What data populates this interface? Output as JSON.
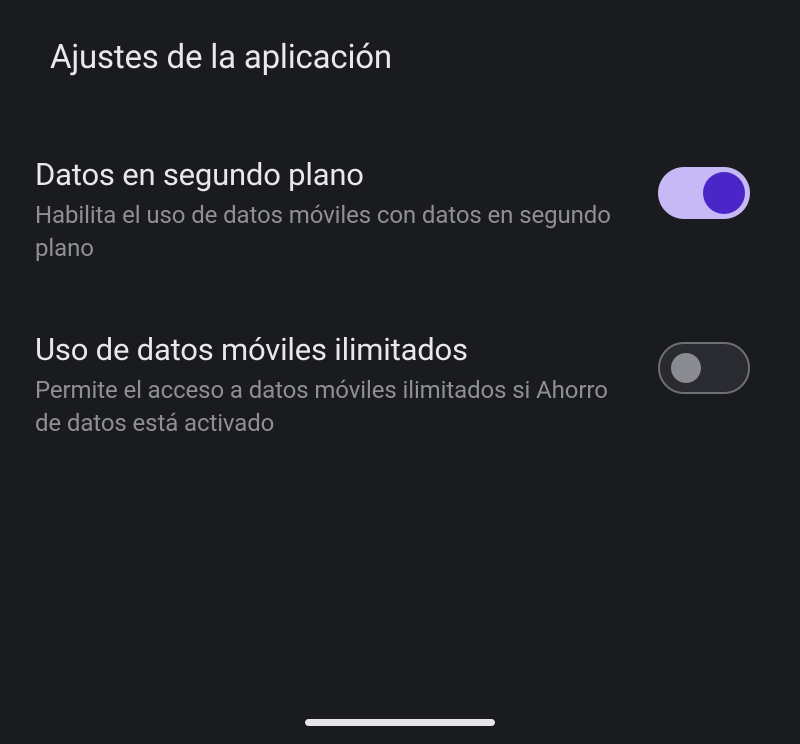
{
  "header": {
    "title": "Ajustes de la aplicación"
  },
  "settings": [
    {
      "title": "Datos en segundo plano",
      "subtitle": "Habilita el uso de datos móviles con datos en segundo plano",
      "enabled": true
    },
    {
      "title": "Uso de datos móviles ilimitados",
      "subtitle": "Permite el acceso a datos móviles ilimitados si Ahorro de datos está activado",
      "enabled": false
    }
  ]
}
